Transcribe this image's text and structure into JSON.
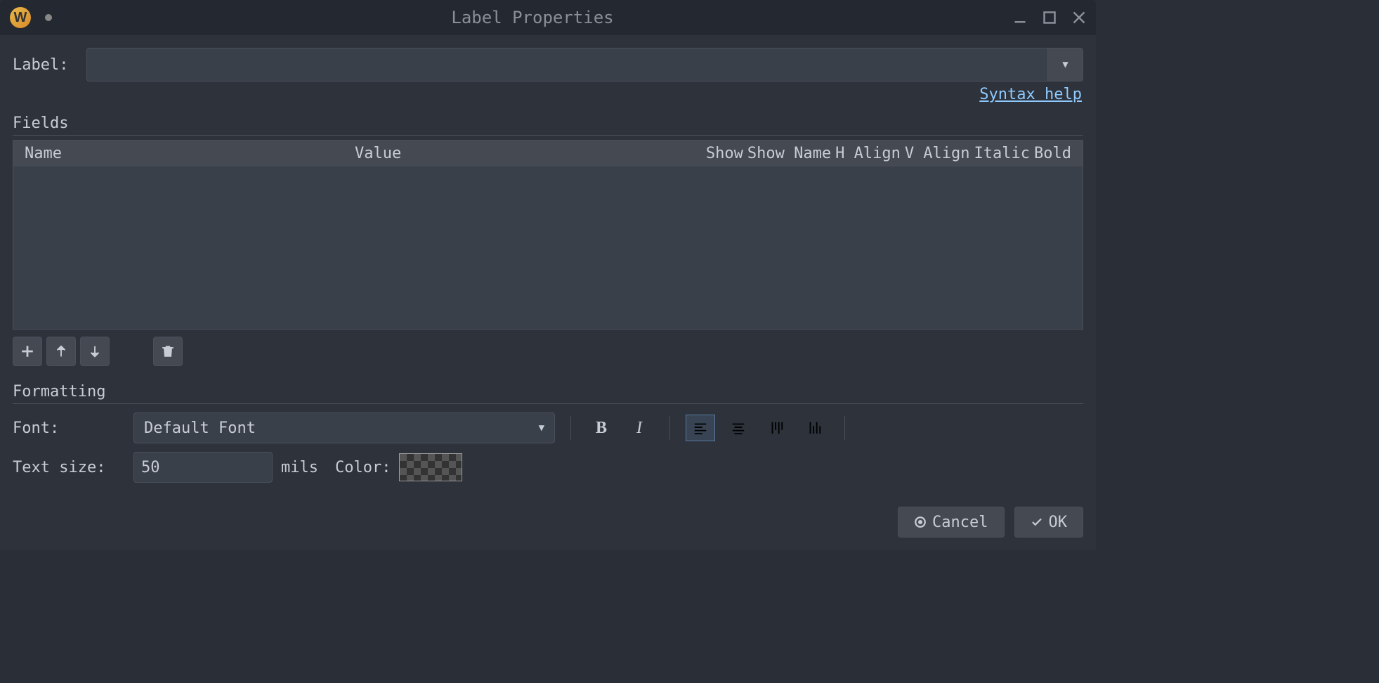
{
  "window": {
    "title": "Label Properties",
    "app_icon_letter": "W"
  },
  "label_section": {
    "label_text": "Label:",
    "label_value": ""
  },
  "syntax_help": "Syntax help",
  "fields": {
    "title": "Fields",
    "columns": {
      "name": "Name",
      "value": "Value",
      "show": "Show",
      "show_name": "Show Name",
      "h_align": "H Align",
      "v_align": "V Align",
      "italic": "Italic",
      "bold": "Bold"
    }
  },
  "formatting": {
    "title": "Formatting",
    "font_label": "Font:",
    "font_value": "Default Font",
    "text_size_label": "Text size:",
    "text_size_value": "50",
    "text_size_units": "mils",
    "color_label": "Color:"
  },
  "buttons": {
    "cancel": "Cancel",
    "ok": "OK"
  }
}
